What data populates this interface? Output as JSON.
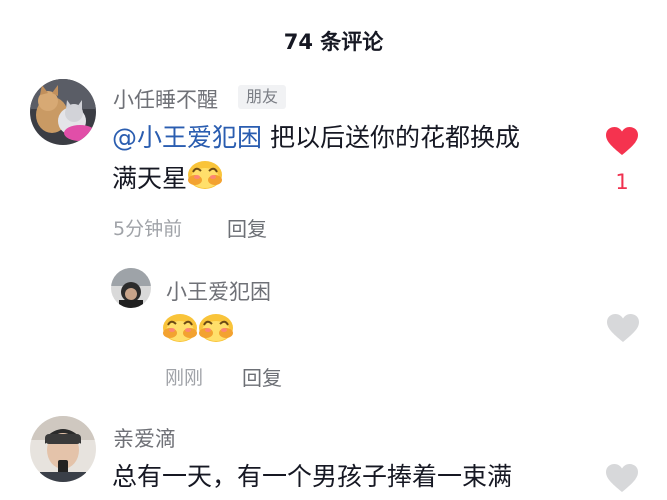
{
  "header": {
    "title": "74 条评论"
  },
  "comments": [
    {
      "author": "小任睡不醒",
      "badge": "朋友",
      "mention": "@小王爱犯困",
      "text_line1": " 把以后送你的花都换成",
      "text_line2": "满天星",
      "time": "5分钟前",
      "reply_label": "回复",
      "liked": true,
      "like_count": "1",
      "like_color": "#f5334f",
      "replies": [
        {
          "author": "小王爱犯困",
          "time": "刚刚",
          "reply_label": "回复",
          "liked": false
        }
      ]
    },
    {
      "author": "亲爱滴",
      "text_line1": "总有一天，有一个男孩子捧着一束满",
      "liked": false
    }
  ],
  "colors": {
    "accent": "#2a5db0",
    "like_active": "#f5334f",
    "like_inactive": "#d7d8da"
  },
  "icons": {
    "like": "heart-icon",
    "emoji": "shy-face-emoji"
  }
}
